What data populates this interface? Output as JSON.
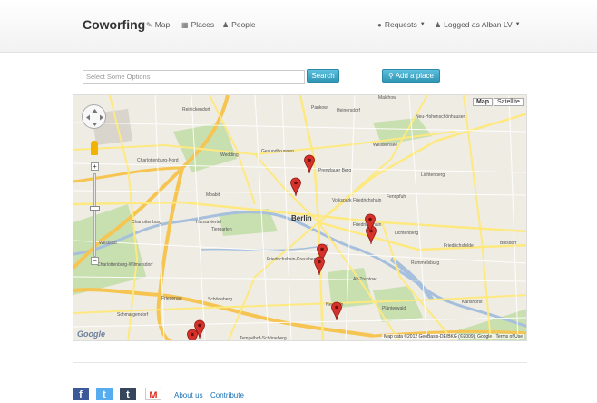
{
  "navbar": {
    "brand": "Coworfing",
    "links": [
      {
        "label": "Map",
        "icon": "map-icon"
      },
      {
        "label": "Places",
        "icon": "grid-icon"
      },
      {
        "label": "People",
        "icon": "person-icon"
      }
    ],
    "requests": {
      "label": "Requests",
      "icon": "info-icon"
    },
    "user": {
      "label": "Logged as Alban LV",
      "icon": "person-icon"
    }
  },
  "search": {
    "placeholder": "Select Some Options",
    "button": "Search"
  },
  "add_place": {
    "label": "Add a place",
    "icon": "pin-icon"
  },
  "map": {
    "type_buttons": [
      "Map",
      "Satellite"
    ],
    "active_type": "Map",
    "city_label": "Berlin",
    "labels": {
      "reinickendorf": "Reinickendorf",
      "pankow": "Pankow",
      "heinersdorf": "Heinersdorf",
      "malchow": "Malchow",
      "hohenschoenhausen": "Neu-Hohenschönhausen",
      "gesundbrunnen": "Gesundbrunnen",
      "prenzlauer": "Prenzlauer Berg",
      "weissensee": "Weissensee",
      "lichtenberg_top": "Lichtenberg",
      "wedding": "Wedding",
      "charlottenburg_nord": "Charlottenburg-Nord",
      "moabit": "Moabit",
      "fennpfuhl": "Fennpfuhl",
      "charlottenburg": "Charlottenburg",
      "tiergarten": "Tiergarten",
      "hansaviertel": "Hansaviertel",
      "friedrichshain": "Friedrichshain",
      "lichtenberg": "Lichtenberg",
      "westend": "Westend",
      "wilmersdorf": "Charlottenburg-Wilmersdorf",
      "friedrichshain_kreuzberg": "Friedrichshain-Kreuzberg",
      "rummelsburg": "Rummelsburg",
      "alt_treptow": "Alt-Treptow",
      "schoeneberg": "Schöneberg",
      "karlshorst": "Karlshorst",
      "schmargendorf": "Schmargendorf",
      "neukoelln": "Neukölln",
      "plaenterwald": "Plänterwald",
      "friedenau": "Friedenau",
      "tempelhof": "Tempelhof-Schöneberg",
      "biesdorf": "Biesdorf",
      "friedrichsfelde": "Friedrichsfelde",
      "volkspark": "Volkspark Friedrichshain"
    },
    "attribution": "Map data ©2012 GeoBasis-DE/BKG (©2009), Google - Terms of Use",
    "google_logo": "Google"
  },
  "footer": {
    "about": "About us",
    "contribute": "Contribute",
    "social": [
      {
        "name": "facebook",
        "glyph": "f",
        "color": "#3b5998"
      },
      {
        "name": "twitter",
        "glyph": "t",
        "color": "#55acee"
      },
      {
        "name": "tumblr",
        "glyph": "t",
        "color": "#35465c"
      },
      {
        "name": "gmail",
        "glyph": "M",
        "color": "#d93025"
      }
    ]
  }
}
